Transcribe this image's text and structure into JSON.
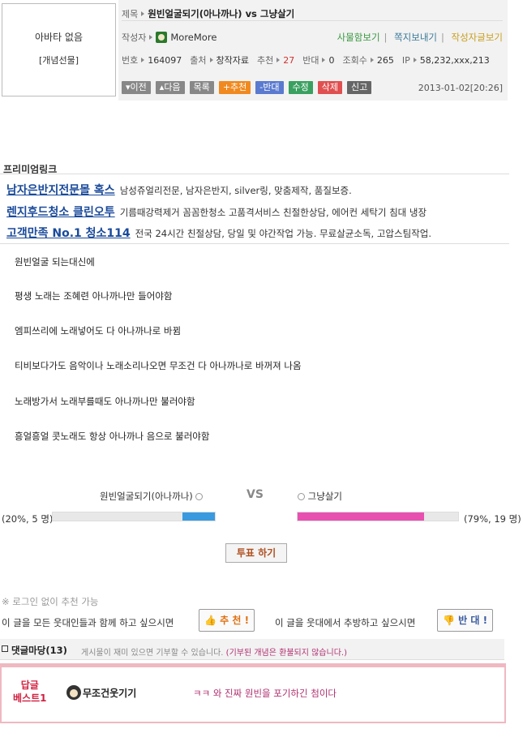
{
  "author_box": {
    "avatar": "아바타 없음",
    "gift": "[개념선물]"
  },
  "post": {
    "title_label": "제목",
    "title": "원빈얼굴되기(아나까나) vs 그냥살기",
    "author_label": "작성자",
    "author": "MoreMore",
    "links": [
      "사물함보기",
      "쪽지보내기",
      "작성자글보기"
    ],
    "meta": [
      {
        "label": "번호",
        "value": "164097"
      },
      {
        "label": "출처",
        "value": "창작자료"
      },
      {
        "label": "추천",
        "value": "27"
      },
      {
        "label": "반대",
        "value": "0"
      },
      {
        "label": "조회수",
        "value": "265"
      },
      {
        "label": "IP",
        "value": "58,232,xxx,213"
      }
    ],
    "buttons": [
      "이전",
      "다음",
      "목록",
      "+추천",
      "-반대",
      "수정",
      "삭제",
      "신고"
    ],
    "date": "2013-01-02[20:26]"
  },
  "premium": {
    "title": "프리미엄링크",
    "ads": [
      {
        "headline": "남자은반지전문몰 혹스",
        "text": "남성쥬얼리전문, 남자은반지, silver링, 맞춤제작, 품질보증."
      },
      {
        "headline": "렌지후드청소 클린오투",
        "text": "기름때강력제거 꼼꼼한청소 고품격서비스 친절한상담, 에어컨 세탁기 침대 냉장"
      },
      {
        "headline": "고객만족 No.1 청소114",
        "text": "전국 24시간 친절상담, 당일 및 야간작업 가능. 무료살균소독, 고압스팀작업."
      }
    ]
  },
  "body": [
    "원빈얼굴 되는대신에",
    "평생 노래는 조혜련 아나까나만 들어야함",
    "엠피쓰리에 노래넣어도 다 아나까나로 바뀜",
    "티비보다가도 음악이나 노래소리나오면 무조건 다 아나까나로 바꺼져 나옴",
    "노래방가서 노래부를때도 아나까나만 불러야함",
    "흥얼흥얼 콧노래도 항상 아나까나 음으로 불러야함"
  ],
  "vote": {
    "option_a": "원빈얼굴되기(아나까나)",
    "option_b": "그냥살기",
    "vs": "VS",
    "result_a": "(20%, 5 명)",
    "result_b": "(79%, 19 명)",
    "pct_a": 0.2,
    "pct_b": 0.79,
    "button": "투표 하기",
    "color_a": "#3a9ae0",
    "color_b": "#e850b0"
  },
  "recommend": {
    "note": "※ 로그인 없이 추천 가능",
    "text_up": "이 글을 모든 웃대인들과 함께 하고 싶으시면",
    "btn_up": "추 천 !",
    "text_down": "이 글을 웃대에서 추방하고 싶으시면",
    "btn_down": "반 대 !"
  },
  "comments": {
    "title": "댓글마당(13)",
    "notice": "게시물이 재미 있으면 기부할 수 있습니다.",
    "notice2": "(기부된 개념은 환불되지 않습니다.)",
    "best_label": "답글\n베스트1",
    "user": "무조건웃기기",
    "text": "ㅋㅋ 와 진짜 원빈을 포기하긴 첨이다"
  }
}
